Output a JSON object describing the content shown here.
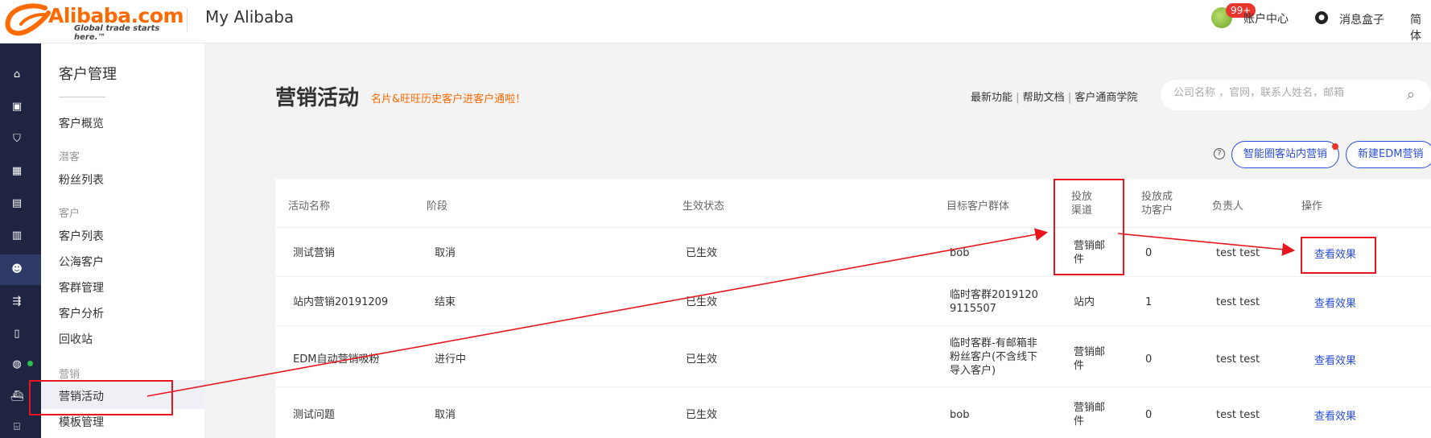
{
  "topbar": {
    "logo_word": "Alibaba.com",
    "logo_tagline": "Global trade starts here.™",
    "my_alibaba": "My Alibaba",
    "badge": "99+",
    "account_center": "账户中心",
    "message_box": "消息盒子",
    "language": "简体"
  },
  "rail": {
    "icons": [
      "home-icon",
      "store-icon",
      "shield-icon",
      "apps-icon",
      "chat-icon",
      "chart-icon",
      "customers-icon",
      "share-icon",
      "clipboard-icon",
      "globe-icon",
      "ship-icon",
      "bank-icon"
    ]
  },
  "sidebar": {
    "title": "客户管理",
    "overview": "客户概览",
    "group_leads": "潜客",
    "fans_list": "粉丝列表",
    "group_customers": "客户",
    "customer_list": "客户列表",
    "public_customers": "公海客户",
    "group_management": "客群管理",
    "customer_analysis": "客户分析",
    "recycle_bin": "回收站",
    "group_marketing": "营销",
    "marketing_activity": "营销活动",
    "template_management": "模板管理"
  },
  "page": {
    "title": "营销活动",
    "subtitle": "名片&旺旺历史客户进客户通啦！",
    "links": [
      "最新功能",
      "帮助文档",
      "客户通商学院"
    ],
    "search_placeholder": "公司名称 ，官网，联系人姓名，邮箱",
    "help": "?",
    "btn_site_marketing": "智能圈客站内营销",
    "btn_new_edm": "新建EDM营销"
  },
  "table": {
    "headers": {
      "name": "活动名称",
      "stage": "阶段",
      "status": "生效状态",
      "target": "目标客户群体",
      "channel": "投放渠道",
      "success": "投放成功客户",
      "owner": "负责人",
      "action": "操作"
    },
    "rows": [
      {
        "name": "测试营销",
        "stage": "取消",
        "status": "已生效",
        "target": "bob",
        "channel": "营销邮件",
        "success": "0",
        "owner": "test test",
        "action": "查看效果"
      },
      {
        "name": "站内营销20191209",
        "stage": "结束",
        "status": "已生效",
        "target": "临时客群20191209115507",
        "channel": "站内",
        "success": "1",
        "owner": "test test",
        "action": "查看效果"
      },
      {
        "name": "EDM自动营销吸粉",
        "stage": "进行中",
        "status": "已生效",
        "target": "临时客群-有邮箱非粉丝客户(不含线下导入客户)",
        "channel": "营销邮件",
        "success": "0",
        "owner": "test test",
        "action": "查看效果"
      },
      {
        "name": "测试问题",
        "stage": "取消",
        "status": "已生效",
        "target": "bob",
        "channel": "营销邮件",
        "success": "0",
        "owner": "test test",
        "action": "查看效果"
      }
    ]
  },
  "annotation_color": "#e8161c"
}
